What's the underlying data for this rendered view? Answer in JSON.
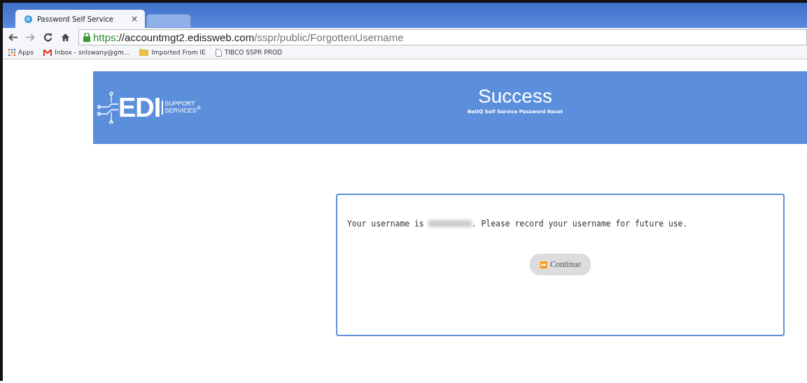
{
  "browser": {
    "tabs": [
      {
        "title": "Password Self Service",
        "close": "×",
        "selected": true
      },
      {
        "selected": false
      }
    ],
    "url": {
      "secure": "https",
      "host": "://accountmgt2.edissweb.com",
      "path": "/sspr/public/ForgottenUsername"
    },
    "bookmarks": [
      {
        "kind": "apps",
        "label": "Apps"
      },
      {
        "kind": "mail",
        "label": "Inbox - snlswany@gm..."
      },
      {
        "kind": "folder",
        "label": "Imported From IE"
      },
      {
        "kind": "page",
        "label": "TIBCO SSPR PROD"
      }
    ]
  },
  "header": {
    "logo": {
      "main": "EDI",
      "line_1": "SUPPORT",
      "line_2": "SERVICES"
    },
    "title": "Success",
    "subtitle": "NetIQ Self Service Password Reset"
  },
  "message": {
    "before": "Your username is",
    "after": ". Please record your username for future use."
  },
  "button": {
    "icon": "⏩",
    "label": "Continue"
  }
}
